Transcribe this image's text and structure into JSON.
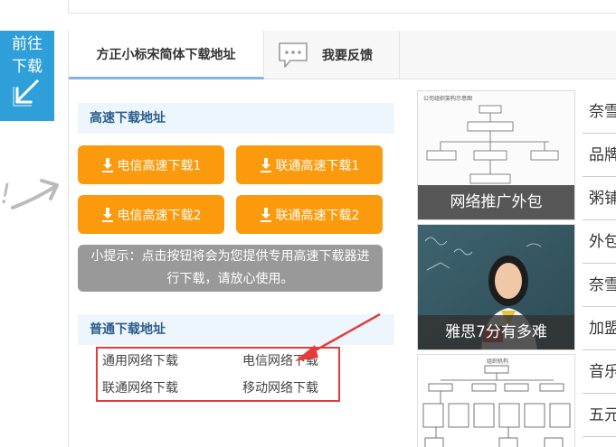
{
  "goto": {
    "label": "前往下载"
  },
  "tabs": {
    "download": "方正小标宋简体下载地址",
    "feedback": "我要反馈"
  },
  "fast": {
    "title": "高速下载地址",
    "buttons": [
      "电信高速下载1",
      "联通高速下载1",
      "电信高速下载2",
      "联通高速下载2"
    ],
    "tip": "小提示：点击按钮将会为您提供专用高速下载器进行下载，请放心使用。"
  },
  "normal": {
    "title": "普通下载地址",
    "links": [
      "通用网络下载",
      "电信网络下载",
      "联通网络下载",
      "移动网络下载"
    ]
  },
  "cards": [
    {
      "caption": "网络推广外包",
      "header_text": "公司组织架构示意图"
    },
    {
      "caption": "雅思7分有多难"
    },
    {
      "caption": "",
      "header_text": "组织机构"
    }
  ],
  "side_list": [
    "奈雪",
    "品牌",
    "粥铺",
    "外包",
    "奈雪",
    "加盟",
    "音乐",
    "五元"
  ],
  "colors": {
    "accent_blue": "#2e9fd8",
    "download_orange": "#fb9a0c",
    "highlight_red": "#e53b3b",
    "section_bg": "#eef6fd"
  }
}
